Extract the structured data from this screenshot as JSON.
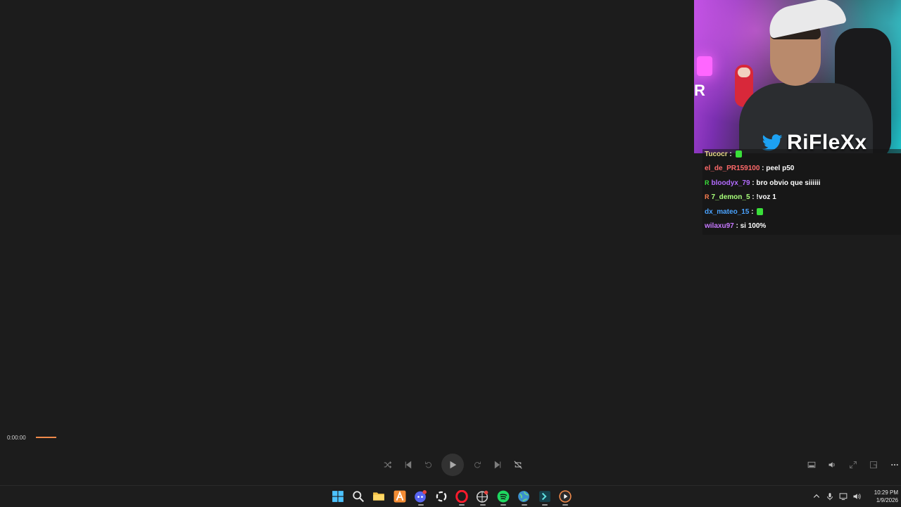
{
  "webcam": {
    "brand_text": "RiFleXx",
    "side_letter": "R"
  },
  "chat": {
    "messages": [
      {
        "user": "Tucocr",
        "user_color": "#e8d98a",
        "badge": "",
        "badge_color": "",
        "text": "",
        "emote": true
      },
      {
        "user": "el_de_PR159100",
        "user_color": "#ff6a6a",
        "badge": "",
        "badge_color": "",
        "text": "peel p50",
        "emote": false
      },
      {
        "user": "bloodyx_79",
        "user_color": "#b36bff",
        "badge": "R",
        "badge_color": "#3adf3a",
        "text": "bro obvio que siiiiii",
        "emote": false
      },
      {
        "user": "7_demon_5",
        "user_color": "#a8ff7a",
        "badge": "R",
        "badge_color": "#ff7f50",
        "text": "!voz 1",
        "emote": false
      },
      {
        "user": "dx_mateo_15",
        "user_color": "#4aa3ff",
        "badge": "",
        "badge_color": "",
        "text": "",
        "emote": true
      },
      {
        "user": "wilaxu97",
        "user_color": "#c678ff",
        "badge": "",
        "badge_color": "",
        "text": "si 100%",
        "emote": false
      }
    ]
  },
  "player": {
    "elapsed": "0:00:00",
    "progress_fraction": 0.0,
    "accent": "#f08a4b",
    "controls": [
      "shuffle-icon",
      "previous-icon",
      "rewind-10-icon",
      "play-icon",
      "forward-30-icon",
      "next-icon",
      "repeat-off-icon"
    ],
    "right_controls": [
      "miniplayer-icon",
      "volume-icon",
      "fullscreen-icon",
      "compact-icon",
      "more-icon"
    ]
  },
  "taskbar": {
    "apps": [
      "windows-start-icon",
      "search-icon",
      "file-explorer-icon",
      "app-a-icon",
      "discord-icon",
      "app-ring-icon",
      "opera-icon",
      "app-ball-icon",
      "spotify-icon",
      "browser-globe-icon",
      "app-terminal-icon",
      "media-player-icon"
    ],
    "discord_badge": "6",
    "time": "10:29 PM",
    "date": "1/9/2026"
  }
}
